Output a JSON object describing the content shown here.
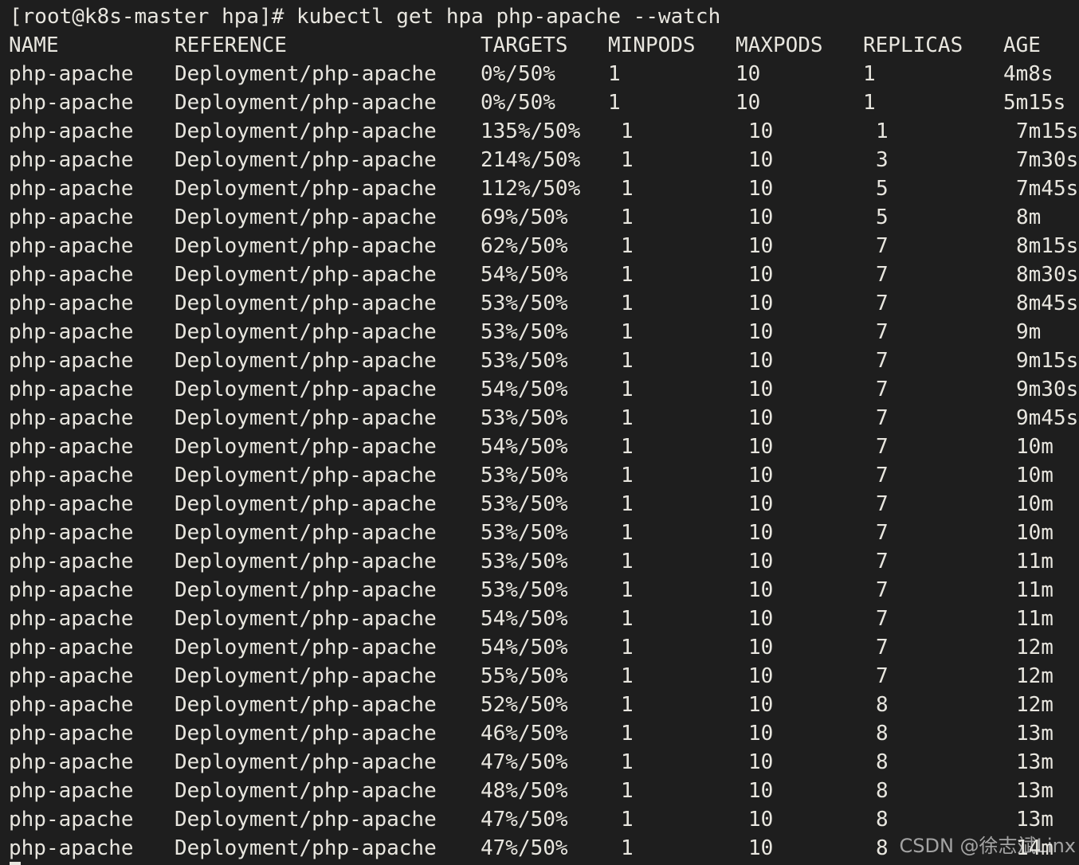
{
  "prompt": {
    "text": "[root@k8s-master hpa]# kubectl get hpa php-apache --watch"
  },
  "table": {
    "headers": [
      "NAME",
      "REFERENCE",
      "TARGETS",
      "MINPODS",
      "MAXPODS",
      "REPLICAS",
      "AGE"
    ],
    "rows": [
      {
        "name": "php-apache",
        "reference": "Deployment/php-apache",
        "targets": "0%/50%",
        "minpods": "1",
        "maxpods": "10",
        "replicas": "1",
        "age": "4m8s",
        "shift": false
      },
      {
        "name": "php-apache",
        "reference": "Deployment/php-apache",
        "targets": "0%/50%",
        "minpods": "1",
        "maxpods": "10",
        "replicas": "1",
        "age": "5m15s",
        "shift": false
      },
      {
        "name": "php-apache",
        "reference": "Deployment/php-apache",
        "targets": "135%/50%",
        "minpods": "1",
        "maxpods": "10",
        "replicas": "1",
        "age": "7m15s",
        "shift": true
      },
      {
        "name": "php-apache",
        "reference": "Deployment/php-apache",
        "targets": "214%/50%",
        "minpods": "1",
        "maxpods": "10",
        "replicas": "3",
        "age": "7m30s",
        "shift": true
      },
      {
        "name": "php-apache",
        "reference": "Deployment/php-apache",
        "targets": "112%/50%",
        "minpods": "1",
        "maxpods": "10",
        "replicas": "5",
        "age": "7m45s",
        "shift": true
      },
      {
        "name": "php-apache",
        "reference": "Deployment/php-apache",
        "targets": "69%/50%",
        "minpods": "1",
        "maxpods": "10",
        "replicas": "5",
        "age": "8m",
        "shift": true
      },
      {
        "name": "php-apache",
        "reference": "Deployment/php-apache",
        "targets": "62%/50%",
        "minpods": "1",
        "maxpods": "10",
        "replicas": "7",
        "age": "8m15s",
        "shift": true
      },
      {
        "name": "php-apache",
        "reference": "Deployment/php-apache",
        "targets": "54%/50%",
        "minpods": "1",
        "maxpods": "10",
        "replicas": "7",
        "age": "8m30s",
        "shift": true
      },
      {
        "name": "php-apache",
        "reference": "Deployment/php-apache",
        "targets": "53%/50%",
        "minpods": "1",
        "maxpods": "10",
        "replicas": "7",
        "age": "8m45s",
        "shift": true
      },
      {
        "name": "php-apache",
        "reference": "Deployment/php-apache",
        "targets": "53%/50%",
        "minpods": "1",
        "maxpods": "10",
        "replicas": "7",
        "age": "9m",
        "shift": true
      },
      {
        "name": "php-apache",
        "reference": "Deployment/php-apache",
        "targets": "53%/50%",
        "minpods": "1",
        "maxpods": "10",
        "replicas": "7",
        "age": "9m15s",
        "shift": true
      },
      {
        "name": "php-apache",
        "reference": "Deployment/php-apache",
        "targets": "54%/50%",
        "minpods": "1",
        "maxpods": "10",
        "replicas": "7",
        "age": "9m30s",
        "shift": true
      },
      {
        "name": "php-apache",
        "reference": "Deployment/php-apache",
        "targets": "53%/50%",
        "minpods": "1",
        "maxpods": "10",
        "replicas": "7",
        "age": "9m45s",
        "shift": true
      },
      {
        "name": "php-apache",
        "reference": "Deployment/php-apache",
        "targets": "54%/50%",
        "minpods": "1",
        "maxpods": "10",
        "replicas": "7",
        "age": "10m",
        "shift": true
      },
      {
        "name": "php-apache",
        "reference": "Deployment/php-apache",
        "targets": "53%/50%",
        "minpods": "1",
        "maxpods": "10",
        "replicas": "7",
        "age": "10m",
        "shift": true
      },
      {
        "name": "php-apache",
        "reference": "Deployment/php-apache",
        "targets": "53%/50%",
        "minpods": "1",
        "maxpods": "10",
        "replicas": "7",
        "age": "10m",
        "shift": true
      },
      {
        "name": "php-apache",
        "reference": "Deployment/php-apache",
        "targets": "53%/50%",
        "minpods": "1",
        "maxpods": "10",
        "replicas": "7",
        "age": "10m",
        "shift": true
      },
      {
        "name": "php-apache",
        "reference": "Deployment/php-apache",
        "targets": "53%/50%",
        "minpods": "1",
        "maxpods": "10",
        "replicas": "7",
        "age": "11m",
        "shift": true
      },
      {
        "name": "php-apache",
        "reference": "Deployment/php-apache",
        "targets": "53%/50%",
        "minpods": "1",
        "maxpods": "10",
        "replicas": "7",
        "age": "11m",
        "shift": true
      },
      {
        "name": "php-apache",
        "reference": "Deployment/php-apache",
        "targets": "54%/50%",
        "minpods": "1",
        "maxpods": "10",
        "replicas": "7",
        "age": "11m",
        "shift": true
      },
      {
        "name": "php-apache",
        "reference": "Deployment/php-apache",
        "targets": "54%/50%",
        "minpods": "1",
        "maxpods": "10",
        "replicas": "7",
        "age": "12m",
        "shift": true
      },
      {
        "name": "php-apache",
        "reference": "Deployment/php-apache",
        "targets": "55%/50%",
        "minpods": "1",
        "maxpods": "10",
        "replicas": "7",
        "age": "12m",
        "shift": true
      },
      {
        "name": "php-apache",
        "reference": "Deployment/php-apache",
        "targets": "52%/50%",
        "minpods": "1",
        "maxpods": "10",
        "replicas": "8",
        "age": "12m",
        "shift": true
      },
      {
        "name": "php-apache",
        "reference": "Deployment/php-apache",
        "targets": "46%/50%",
        "minpods": "1",
        "maxpods": "10",
        "replicas": "8",
        "age": "13m",
        "shift": true
      },
      {
        "name": "php-apache",
        "reference": "Deployment/php-apache",
        "targets": "47%/50%",
        "minpods": "1",
        "maxpods": "10",
        "replicas": "8",
        "age": "13m",
        "shift": true
      },
      {
        "name": "php-apache",
        "reference": "Deployment/php-apache",
        "targets": "48%/50%",
        "minpods": "1",
        "maxpods": "10",
        "replicas": "8",
        "age": "13m",
        "shift": true
      },
      {
        "name": "php-apache",
        "reference": "Deployment/php-apache",
        "targets": "47%/50%",
        "minpods": "1",
        "maxpods": "10",
        "replicas": "8",
        "age": "13m",
        "shift": true
      },
      {
        "name": "php-apache",
        "reference": "Deployment/php-apache",
        "targets": "47%/50%",
        "minpods": "1",
        "maxpods": "10",
        "replicas": "8",
        "age": "14m",
        "shift": true
      }
    ]
  },
  "watermark": {
    "text": "CSDN @徐志斌Linx"
  },
  "colors": {
    "background": "#1e1e1e",
    "foreground": "#e8e6df"
  }
}
